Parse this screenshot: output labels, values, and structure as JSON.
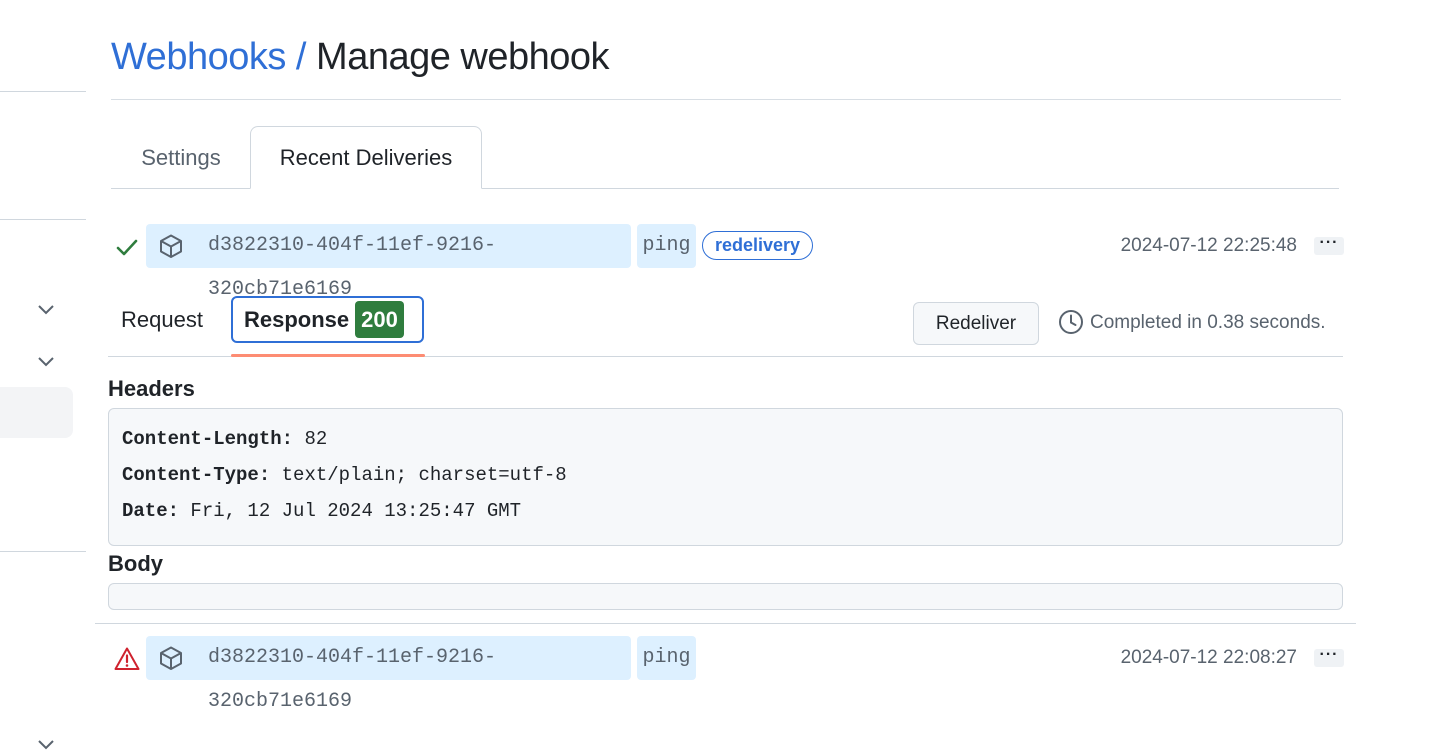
{
  "breadcrumb": {
    "parent": "Webhooks",
    "separator": "/",
    "current": "Manage webhook"
  },
  "tabs": [
    {
      "label": "Settings",
      "selected": false
    },
    {
      "label": "Recent Deliveries",
      "selected": true
    }
  ],
  "deliveries": [
    {
      "status": "success",
      "status_icon": "check-icon",
      "guid": "d3822310-404f-11ef-9216-320cb71e6169",
      "event": "ping",
      "badge": "redelivery",
      "timestamp": "2024-07-12 22:25:48",
      "more_label": "···",
      "expanded": true
    },
    {
      "status": "failure",
      "status_icon": "alert-icon",
      "guid": "d3822310-404f-11ef-9216-320cb71e6169",
      "event": "ping",
      "timestamp": "2024-07-12 22:08:27",
      "more_label": "···",
      "expanded": false
    }
  ],
  "detail": {
    "request_tab": "Request",
    "response_tab": "Response",
    "response_code": "200",
    "redeliver_label": "Redeliver",
    "completed_text": "Completed in 0.38 seconds.",
    "headers_title": "Headers",
    "headers": [
      {
        "key": "Content-Length:",
        "value": "82"
      },
      {
        "key": "Content-Type:",
        "value": "text/plain; charset=utf-8"
      },
      {
        "key": "Date:",
        "value": "Fri, 12 Jul 2024 13:25:47 GMT"
      }
    ],
    "body_title": "Body",
    "body": ""
  },
  "colors": {
    "link": "#2f6fd6",
    "success": "#2f7d3e",
    "danger": "#cf222e",
    "chip_bg": "#ddf0ff",
    "tab_underline": "#fd8c73"
  }
}
